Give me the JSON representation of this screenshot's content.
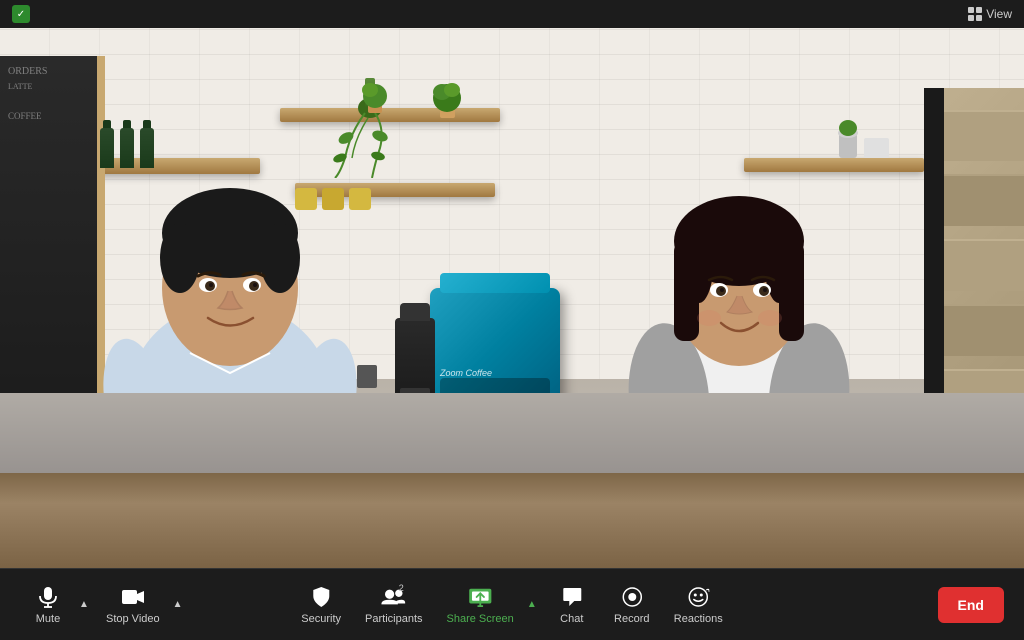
{
  "titlebar": {
    "shield_label": "✓",
    "view_label": "View",
    "grid_icon": "⊞"
  },
  "toolbar": {
    "mute_label": "Mute",
    "stop_video_label": "Stop Video",
    "security_label": "Security",
    "participants_label": "Participants",
    "participants_count": "2",
    "share_screen_label": "Share Screen",
    "chat_label": "Chat",
    "record_label": "Record",
    "reactions_label": "Reactions",
    "end_label": "End"
  },
  "colors": {
    "toolbar_bg": "#1c1c1c",
    "active_green": "#4CAF50",
    "end_red": "#e03030",
    "shield_green": "#2d8a2d"
  }
}
